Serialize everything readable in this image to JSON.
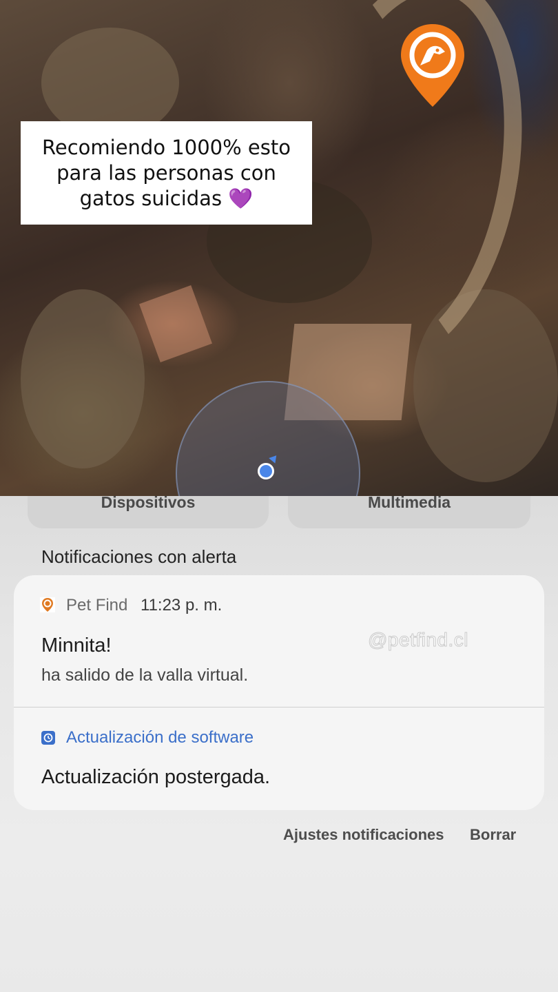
{
  "overlay": {
    "caption": "Recomiendo 1000% esto\npara las personas con\ngatos suicidas",
    "heart": "💜",
    "brand_color": "#f07a1a"
  },
  "quick_settings": {
    "tile_left": "Dispositivos",
    "tile_right": "Multimedia"
  },
  "notifications": {
    "section_title": "Notificaciones con alerta",
    "items": [
      {
        "app_icon": "pet-find-pin-icon",
        "app_name": "Pet Find",
        "time": "11:23 p. m.",
        "title": "Minnita!",
        "body": "ha salido de la valla virtual.",
        "watermark": "@petfind.cl"
      },
      {
        "app_icon": "software-update-icon",
        "app_name": "Actualización de software",
        "app_name_color": "#3b6fc9",
        "title": "Actualización postergada."
      }
    ],
    "actions": {
      "settings": "Ajustes notificaciones",
      "clear": "Borrar"
    }
  }
}
